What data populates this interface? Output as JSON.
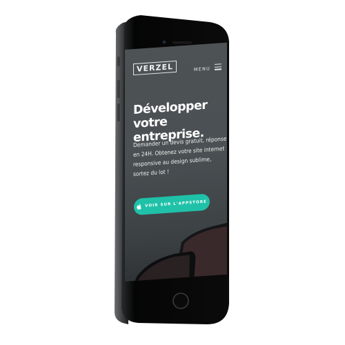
{
  "mockup": {
    "brand": "VERZEL",
    "menu_label": "MENU",
    "headline": "Développer votre entreprise.",
    "body": "Demander un devis gratuit, réponse en 24H. Obtenez votre site internet responsive au design sublime, sortez du lot !",
    "cta_label": "VOIR SUR L'APPSTORE",
    "accent_color": "#1fc1a8",
    "screen_background": "#4a5053",
    "icons": [
      "hamburger-menu-icon",
      "apple-icon"
    ]
  }
}
